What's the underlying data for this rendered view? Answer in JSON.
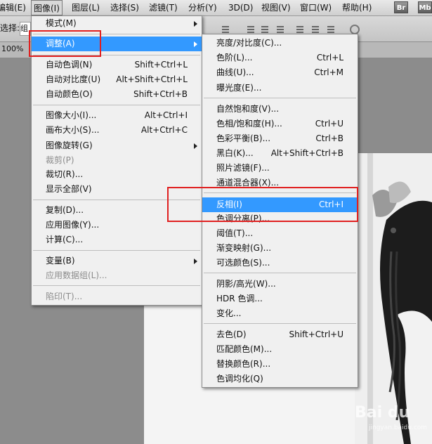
{
  "menubar": {
    "items": [
      "编辑(E)",
      "图像(I)",
      "图层(L)",
      "选择(S)",
      "滤镜(T)",
      "分析(Y)",
      "3D(D)",
      "视图(V)",
      "窗口(W)",
      "帮助(H)"
    ],
    "badges": [
      "Br",
      "Mb"
    ]
  },
  "options_bar": {
    "label": "选择:",
    "input_value": "组"
  },
  "document": {
    "zoom": "100%"
  },
  "image_menu": {
    "items": [
      {
        "label": "模式(M)",
        "shortcut": "",
        "submenu": true
      },
      {
        "label": "调整(A)",
        "shortcut": "",
        "submenu": true
      },
      {
        "label": "自动色调(N)",
        "shortcut": "Shift+Ctrl+L"
      },
      {
        "label": "自动对比度(U)",
        "shortcut": "Alt+Shift+Ctrl+L"
      },
      {
        "label": "自动颜色(O)",
        "shortcut": "Shift+Ctrl+B"
      },
      {
        "label": "图像大小(I)...",
        "shortcut": "Alt+Ctrl+I"
      },
      {
        "label": "画布大小(S)...",
        "shortcut": "Alt+Ctrl+C"
      },
      {
        "label": "图像旋转(G)",
        "shortcut": "",
        "submenu": true
      },
      {
        "label": "裁剪(P)",
        "shortcut": "",
        "disabled": true
      },
      {
        "label": "裁切(R)...",
        "shortcut": ""
      },
      {
        "label": "显示全部(V)",
        "shortcut": ""
      },
      {
        "label": "复制(D)...",
        "shortcut": ""
      },
      {
        "label": "应用图像(Y)...",
        "shortcut": ""
      },
      {
        "label": "计算(C)...",
        "shortcut": ""
      },
      {
        "label": "变量(B)",
        "shortcut": "",
        "submenu": true
      },
      {
        "label": "应用数据组(L)...",
        "shortcut": "",
        "disabled": true
      },
      {
        "label": "陷印(T)...",
        "shortcut": "",
        "disabled": true
      }
    ]
  },
  "adjust_menu": {
    "items": [
      {
        "label": "亮度/对比度(C)...",
        "shortcut": ""
      },
      {
        "label": "色阶(L)...",
        "shortcut": "Ctrl+L"
      },
      {
        "label": "曲线(U)...",
        "shortcut": "Ctrl+M"
      },
      {
        "label": "曝光度(E)...",
        "shortcut": ""
      },
      {
        "label": "自然饱和度(V)...",
        "shortcut": ""
      },
      {
        "label": "色相/饱和度(H)...",
        "shortcut": "Ctrl+U"
      },
      {
        "label": "色彩平衡(B)...",
        "shortcut": "Ctrl+B"
      },
      {
        "label": "黑白(K)...",
        "shortcut": "Alt+Shift+Ctrl+B"
      },
      {
        "label": "照片滤镜(F)...",
        "shortcut": ""
      },
      {
        "label": "通道混合器(X)...",
        "shortcut": ""
      },
      {
        "label": "反相(I)",
        "shortcut": "Ctrl+I"
      },
      {
        "label": "色调分离(P)...",
        "shortcut": ""
      },
      {
        "label": "阈值(T)...",
        "shortcut": ""
      },
      {
        "label": "渐变映射(G)...",
        "shortcut": ""
      },
      {
        "label": "可选颜色(S)...",
        "shortcut": ""
      },
      {
        "label": "阴影/高光(W)...",
        "shortcut": ""
      },
      {
        "label": "HDR 色调...",
        "shortcut": ""
      },
      {
        "label": "变化...",
        "shortcut": ""
      },
      {
        "label": "去色(D)",
        "shortcut": "Shift+Ctrl+U"
      },
      {
        "label": "匹配颜色(M)...",
        "shortcut": ""
      },
      {
        "label": "替换颜色(R)...",
        "shortcut": ""
      },
      {
        "label": "色调均化(Q)",
        "shortcut": ""
      }
    ]
  },
  "watermark": {
    "text": "Bai du",
    "sub": "jingyan.baidu.com"
  },
  "colors": {
    "highlight": "#3399ff",
    "annotation_red": "#e02020"
  }
}
